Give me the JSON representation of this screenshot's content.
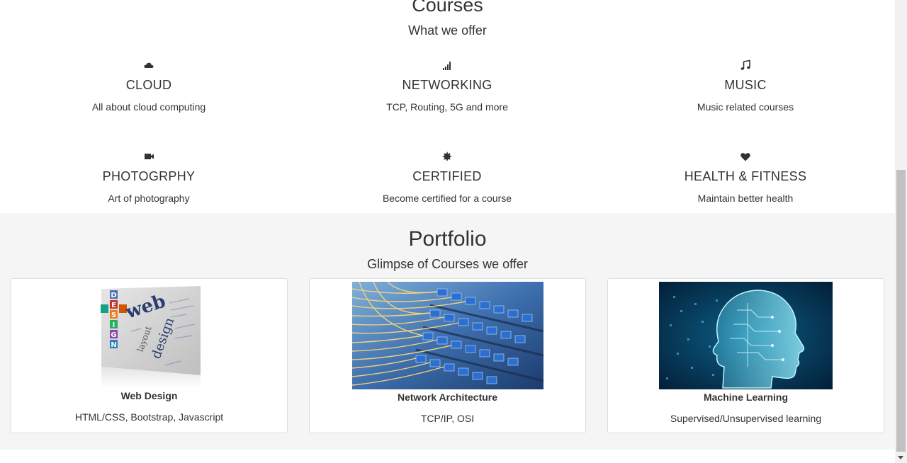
{
  "courses": {
    "title": "Courses",
    "subtitle": "What we offer",
    "items": [
      {
        "icon": "cloud-icon",
        "title": "CLOUD",
        "desc": "All about cloud computing"
      },
      {
        "icon": "signal-icon",
        "title": "NETWORKING",
        "desc": "TCP, Routing, 5G and more"
      },
      {
        "icon": "music-note-icon",
        "title": "MUSIC",
        "desc": "Music related courses"
      },
      {
        "icon": "video-camera-icon",
        "title": "PHOTOGRPHY",
        "desc": "Art of photography"
      },
      {
        "icon": "certificate-icon",
        "title": "CERTIFIED",
        "desc": "Become certified for a course"
      },
      {
        "icon": "heart-icon",
        "title": "HEALTH & FITNESS",
        "desc": "Maintain better health"
      }
    ]
  },
  "portfolio": {
    "title": "Portfolio",
    "subtitle": "Glimpse of Courses we offer",
    "cards": [
      {
        "title": "Web Design",
        "desc": "HTML/CSS, Bootstrap, Javascript"
      },
      {
        "title": "Network Architecture",
        "desc": "TCP/IP, OSI"
      },
      {
        "title": "Machine Learning",
        "desc": "Supervised/Unsupervised learning"
      }
    ],
    "web_design_image": {
      "letters_vertical": "DESIGN",
      "letters_horizontal": "WEB",
      "word_web": "web",
      "word_design": "design",
      "word_layout": "layout"
    }
  },
  "colors": {
    "text": "#333333",
    "portfolio_bg": "#f5f5f5",
    "card_border": "#dddddd"
  }
}
